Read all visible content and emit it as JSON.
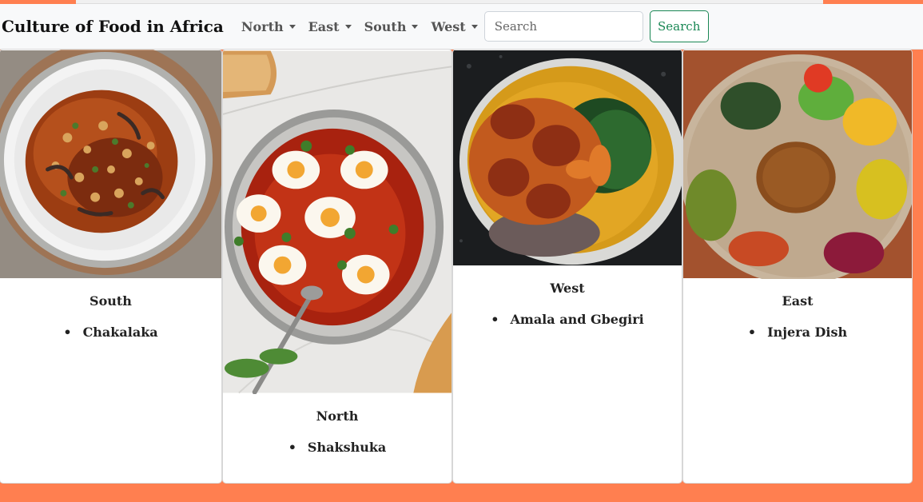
{
  "navbar": {
    "brand": "Culture of Food in Africa",
    "menu": [
      {
        "label": "North"
      },
      {
        "label": "East"
      },
      {
        "label": "South"
      },
      {
        "label": "West"
      }
    ],
    "search": {
      "placeholder": "Search",
      "value": "",
      "button_label": "Search"
    }
  },
  "cards": [
    {
      "region": "South",
      "dish": "Chakalaka",
      "image": "stewed-vegetable-bowl"
    },
    {
      "region": "North",
      "dish": "Shakshuka",
      "image": "eggs-in-tomato-pan"
    },
    {
      "region": "West",
      "dish": "Amala and Gbegiri",
      "image": "stew-with-greens"
    },
    {
      "region": "East",
      "dish": "Injera Dish",
      "image": "injera-platter"
    }
  ],
  "colors": {
    "page_background": "#ff7f50",
    "navbar_background": "#f8f9fa",
    "search_button": "#198754"
  }
}
